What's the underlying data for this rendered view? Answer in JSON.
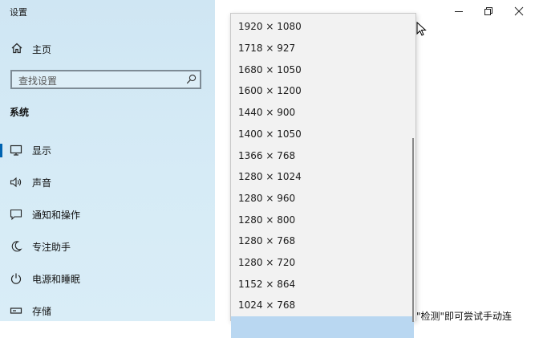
{
  "app": {
    "title": "设置"
  },
  "sidebar": {
    "home_label": "主页",
    "search_placeholder": "查找设置",
    "section_label": "系统",
    "items": [
      {
        "label": "显示",
        "icon": "monitor-icon",
        "active": true
      },
      {
        "label": "声音",
        "icon": "speaker-icon",
        "active": false
      },
      {
        "label": "通知和操作",
        "icon": "notification-icon",
        "active": false
      },
      {
        "label": "专注助手",
        "icon": "moon-icon",
        "active": false
      },
      {
        "label": "电源和睡眠",
        "icon": "power-icon",
        "active": false
      },
      {
        "label": "存储",
        "icon": "storage-icon",
        "active": false
      }
    ]
  },
  "resolution_dropdown": {
    "options": [
      "1920 × 1080",
      "1718 × 927",
      "1680 × 1050",
      "1600 × 1200",
      "1440 × 900",
      "1400 × 1050",
      "1366 × 768",
      "1280 × 1024",
      "1280 × 960",
      "1280 × 800",
      "1280 × 768",
      "1280 × 720",
      "1152 × 864",
      "1024 × 768",
      ""
    ],
    "selected_index": 14
  },
  "main": {
    "detect_text": "\"检测\"即可尝试手动连"
  },
  "colors": {
    "accent": "#0063b1",
    "selection": "#b9d7f1",
    "sidebar_bg": "#d3e9f5"
  }
}
